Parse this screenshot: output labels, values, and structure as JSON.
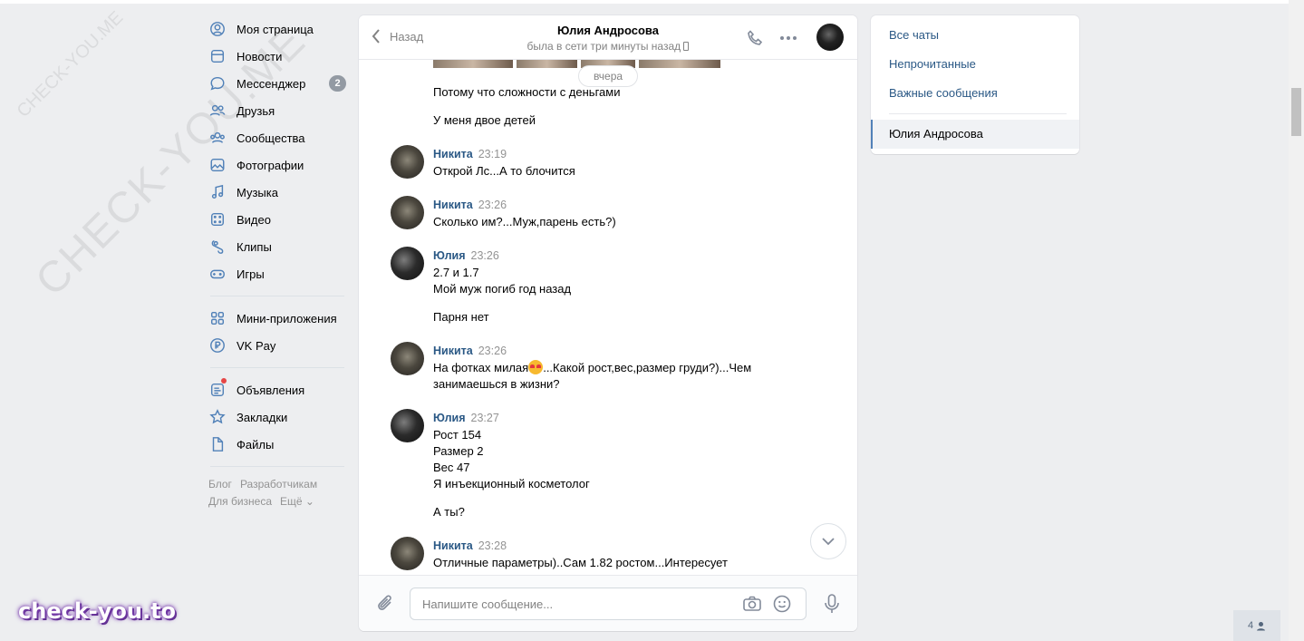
{
  "watermark": {
    "big": "CHECK-YOU.ME",
    "small": "CHECK-YOU.ME",
    "bottom": "check-you.to"
  },
  "menu": {
    "items": [
      {
        "label": "Моя страница",
        "icon": "user-circle-icon"
      },
      {
        "label": "Новости",
        "icon": "news-icon"
      },
      {
        "label": "Мессенджер",
        "icon": "message-icon",
        "badge": "2"
      },
      {
        "label": "Друзья",
        "icon": "friends-icon"
      },
      {
        "label": "Сообщества",
        "icon": "communities-icon"
      },
      {
        "label": "Фотографии",
        "icon": "photo-icon"
      },
      {
        "label": "Музыка",
        "icon": "music-icon"
      },
      {
        "label": "Видео",
        "icon": "video-icon"
      },
      {
        "label": "Клипы",
        "icon": "clips-icon"
      },
      {
        "label": "Игры",
        "icon": "games-icon"
      }
    ],
    "items2": [
      {
        "label": "Мини-приложения",
        "icon": "apps-icon"
      },
      {
        "label": "VK Pay",
        "icon": "vkpay-icon"
      }
    ],
    "items3": [
      {
        "label": "Объявления",
        "icon": "ads-icon"
      },
      {
        "label": "Закладки",
        "icon": "star-icon"
      },
      {
        "label": "Файлы",
        "icon": "file-icon"
      }
    ],
    "footer": [
      "Блог",
      "Разработчикам",
      "Для бизнеса",
      "Ещё ⌄"
    ]
  },
  "chat": {
    "back_label": "Назад",
    "title": "Юлия Андросова",
    "status": "была в сети три минуты назад",
    "day_label": "вчера",
    "messages": [
      {
        "text": "Потому что сложности с деньгами"
      },
      {
        "text": "У меня двое детей"
      },
      {
        "author": "Никита",
        "time": "23:19",
        "text": "Открой Лс...А то блочится"
      },
      {
        "author": "Никита",
        "time": "23:26",
        "text": "Сколько им?...Муж,парень есть?)"
      },
      {
        "author": "Юлия",
        "time": "23:26",
        "lines": [
          "2.7 и 1.7",
          "Мой муж погиб год назад"
        ]
      },
      {
        "text": "Парня нет"
      },
      {
        "author": "Никита",
        "time": "23:26",
        "text_a": "На фотках милая",
        "text_b": "...Какой рост,вес,размер груди?)...Чем",
        "text_c": "занимаешься в жизни?"
      },
      {
        "author": "Юлия",
        "time": "23:27",
        "lines": [
          "Рост 154",
          "Размер 2",
          "Вес 47",
          "Я инъекционный косметолог"
        ]
      },
      {
        "text": "А ты?"
      },
      {
        "author": "Никита",
        "time": "23:28",
        "text": "Отличные параметры)..Сам 1.82 ростом...Интересует"
      }
    ],
    "input_placeholder": "Напишите сообщение..."
  },
  "right_panel": {
    "all_chats": "Все чаты",
    "unread": "Непрочитанные",
    "important": "Важные сообщения",
    "active_chat": "Юлия Андросова"
  },
  "people_count": "4"
}
